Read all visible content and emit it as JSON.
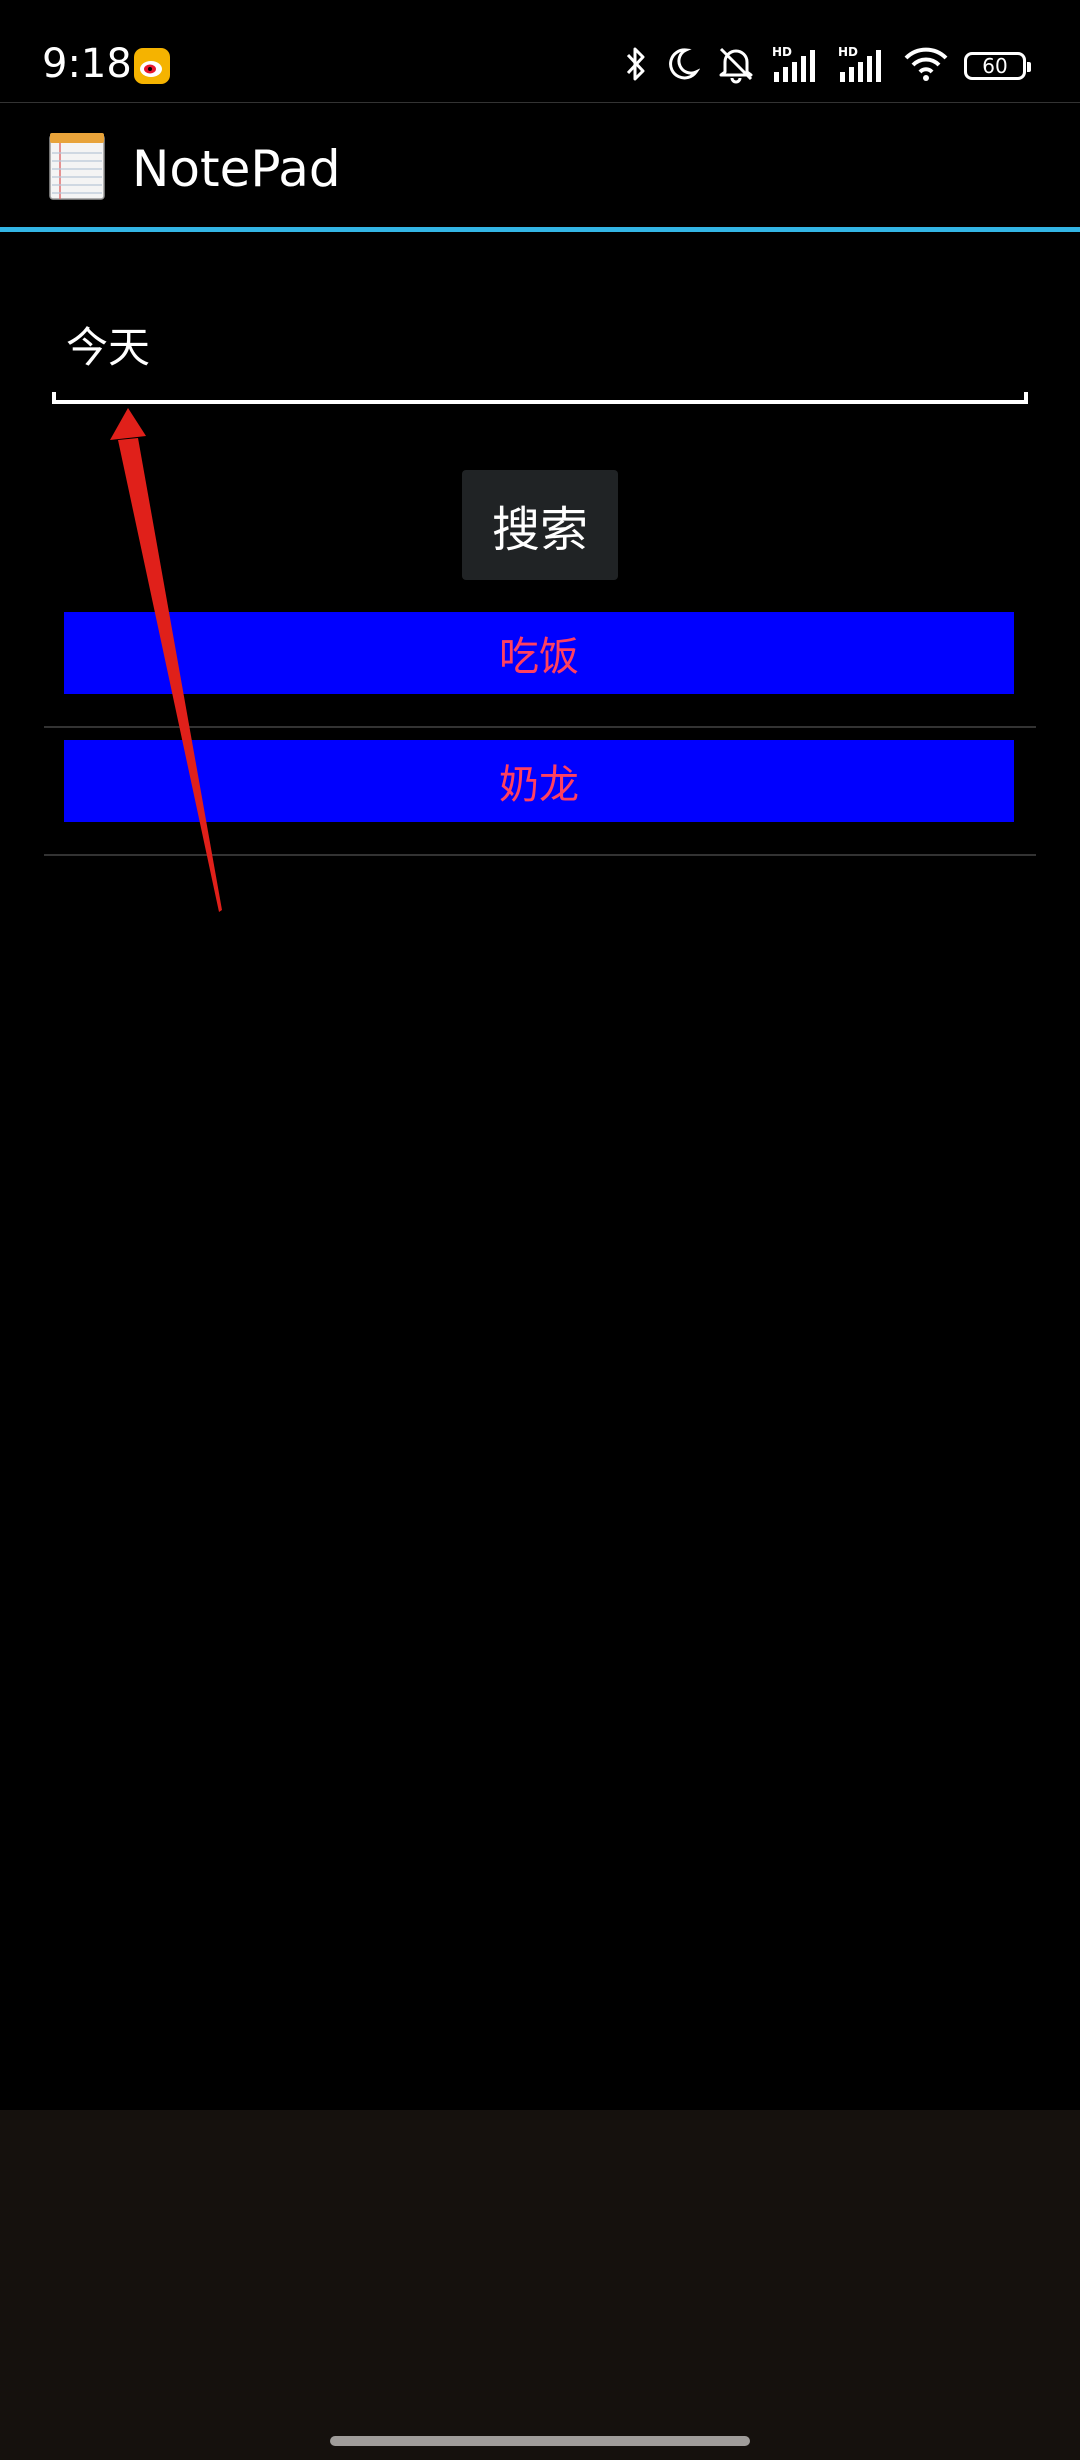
{
  "status_bar": {
    "time": "9:18",
    "battery_level": "60",
    "icons": [
      "weibo-icon",
      "bluetooth-icon",
      "moon-icon",
      "mute-icon",
      "signal-hd-icon",
      "signal-hd-icon",
      "wifi-icon",
      "battery-icon"
    ]
  },
  "app_bar": {
    "title": "NotePad",
    "icon": "notepad-app-icon"
  },
  "search": {
    "value": "今天",
    "button_label": "搜索"
  },
  "results": [
    {
      "title": "吃饭"
    },
    {
      "title": "奶龙"
    }
  ],
  "colors": {
    "background": "#000000",
    "accent": "#33b5e5",
    "item_background": "#0000ff",
    "item_text": "#ff4060",
    "annotation_arrow": "#e0201a",
    "nav_background": "#15110d"
  }
}
